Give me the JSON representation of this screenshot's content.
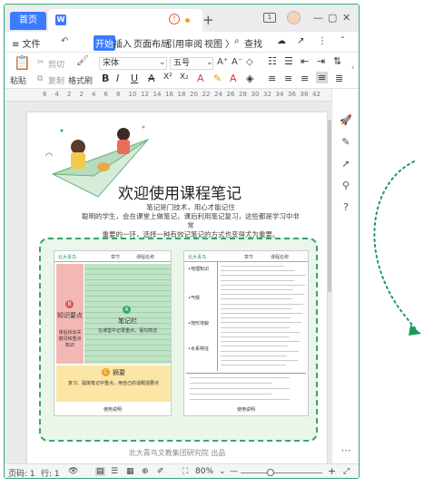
{
  "titlebar": {
    "home_tab": "首页",
    "doc_icon": "W",
    "new_tab": "+",
    "page_badge": "1",
    "minimize": "—",
    "restore": "▢",
    "close": "✕"
  },
  "menubar": {
    "file": "≡ 文件",
    "active_tab": "开始",
    "tabs": [
      "插入",
      "页面布局",
      "引用",
      "审阅",
      "视图"
    ],
    "more": "〉",
    "search": "查找",
    "share": "↗",
    "more_options": "⋮",
    "collapse": "ˆ"
  },
  "ribbon": {
    "paste": "粘贴",
    "cut": "剪切",
    "copy": "复制",
    "format_painter": "格式刷",
    "font_name": "宋体",
    "font_size": "五号",
    "bold": "B",
    "italic": "I",
    "underline": "U",
    "strike": "A"
  },
  "ruler": {
    "ticks": [
      "6",
      "4",
      "2",
      "2",
      "4",
      "6",
      "8",
      "10",
      "12",
      "14",
      "16",
      "18",
      "20",
      "22",
      "24",
      "26",
      "28",
      "30",
      "32",
      "34",
      "36",
      "38",
      "42"
    ]
  },
  "document": {
    "title": "欢迎使用课程笔记",
    "intro_lines": [
      "笔记是门技术，用心才能记住",
      "聪明的学生，会在课堂上做笔记，课后利用笔记复习，这些都是学习中非常",
      "重要的一环，选择一种有效记笔记的方式也变得尤为重要。"
    ],
    "left_template": {
      "header_left": "北大青鸟",
      "header_mid": "章节",
      "header_right": "课程名称",
      "b_badge": "B",
      "b_title": "知识要点",
      "b_desc": "课后找出关键词和重点知识",
      "a_badge": "A",
      "a_title": "笔记栏",
      "a_desc": "在课堂中记录重点，语句简洁",
      "c_badge": "C",
      "c_title": "摘要",
      "c_desc": "复习、提炼笔记中重点，用自己的话概括要点",
      "footer": "使用说明"
    },
    "right_template": {
      "header_left": "北大青鸟",
      "header_mid": "章节",
      "header_right": "课程名称",
      "rows": [
        "•地理知识",
        "•气候",
        "•地形地貌",
        "•水系特征"
      ],
      "footer": "使用说明"
    },
    "publisher": "北大青鸟文教集团研究院 出品"
  },
  "statusbar": {
    "page": "页码: 1",
    "line": "行: 1",
    "zoom": "80%",
    "zoom_minus": "—",
    "zoom_plus": "+"
  },
  "colors": {
    "accent": "#3a7bff",
    "frame": "#2faa72",
    "panel_border": "#3aa56a",
    "arrow": "#1f9a5a"
  }
}
